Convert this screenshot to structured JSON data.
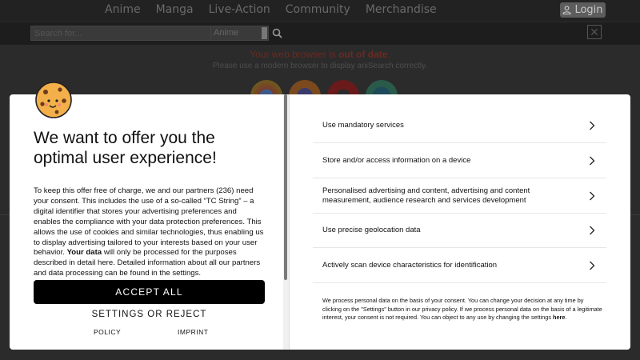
{
  "nav": {
    "items": [
      "Anime",
      "Manga",
      "Live-Action",
      "Community",
      "Merchandise"
    ],
    "login_label": "Login"
  },
  "search": {
    "placeholder": "Search for...",
    "category": "Anime"
  },
  "notice": {
    "prefix": "Your web browser is ",
    "highlight": "out of date",
    "suffix": ".",
    "subtext": "Please use a modern browser to display aniSearch correctly."
  },
  "consent": {
    "headline": "We want to offer you the optimal user experience!",
    "body_main": "To keep this offer free of charge, we and our partners (236) need your consent. This includes the use of a so-called “TC String” – a digital identifier that stores your advertising preferences and enables the compliance with your data protection preferences. This allows the use of cookies and similar technologies, thus enabling us to display advertising tailored to your interests based on your user behavior.",
    "body_bold": "Your data",
    "body_tail": " will only be processed for the purposes described in detail here. Detailed information about all our partners and data processing can be found in the settings.",
    "accept_label": "ACCEPT ALL",
    "settings_label": "SETTINGS OR REJECT",
    "policy_label": "POLICY",
    "imprint_label": "IMPRINT",
    "purposes": [
      "Use mandatory services",
      "Store and/or access information on a device",
      "Personalised advertising and content, advertising and content measurement, audience research and services development",
      "Use precise geolocation data",
      "Actively scan device characteristics for identification"
    ],
    "legal_text": "We process personal data on the basis of your consent. You can change your decision at any time by clicking on the \"Settings\" button in our privacy policy. If we process personal data on the basis of a legitimate interest, your consent is not required. You can object to any use by changing the settings ",
    "legal_link": "here",
    "legal_end": "."
  },
  "colors": {
    "accent_warning": "#6b2a22",
    "accept_bg": "#000000",
    "modal_bg": "#ffffff"
  }
}
